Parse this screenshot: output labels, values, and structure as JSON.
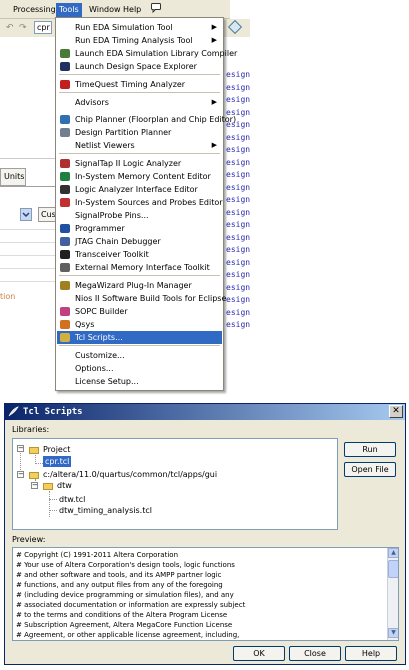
{
  "menubar": {
    "items": [
      "Processing",
      "Tools",
      "Window",
      "Help"
    ],
    "help_icon": "help-bubble-icon"
  },
  "toolbar": {
    "combo_value": "cpr"
  },
  "left_panel": {
    "units_tab": "Units",
    "cust_button": "Cust",
    "partial_text": "tion"
  },
  "code_lines": [
    "esign",
    "esign",
    "esign",
    "esign",
    "esign",
    "esign",
    "esign",
    "esign",
    "esign",
    "esign",
    "esign",
    "esign",
    "esign",
    "esign",
    "esign",
    "esign",
    "esign",
    "esign",
    "esign",
    "esign",
    "esign"
  ],
  "tools_menu": {
    "items": [
      {
        "label": "Run EDA Simulation Tool",
        "icon": "none",
        "submenu": true
      },
      {
        "label": "Run EDA Timing Analysis Tool",
        "icon": "none",
        "submenu": true
      },
      {
        "label": "Launch EDA Simulation Library Compiler",
        "icon": "library-compiler-icon"
      },
      {
        "label": "Launch Design Space Explorer",
        "icon": "design-space-explorer-icon"
      },
      {
        "label": "TimeQuest Timing Analyzer",
        "icon": "timequest-icon"
      },
      {
        "label": "Advisors",
        "icon": "none",
        "submenu": true
      },
      {
        "label": "Chip Planner (Floorplan and Chip Editor)",
        "icon": "chip-planner-icon"
      },
      {
        "label": "Design Partition Planner",
        "icon": "partition-planner-icon"
      },
      {
        "label": "Netlist Viewers",
        "icon": "none",
        "submenu": true
      },
      {
        "label": "SignalTap II Logic Analyzer",
        "icon": "signaltap-icon"
      },
      {
        "label": "In-System Memory Content Editor",
        "icon": "memory-editor-icon"
      },
      {
        "label": "Logic Analyzer Interface Editor",
        "icon": "logic-analyzer-icon"
      },
      {
        "label": "In-System Sources and Probes Editor",
        "icon": "sources-probes-icon"
      },
      {
        "label": "SignalProbe Pins...",
        "icon": "none"
      },
      {
        "label": "Programmer",
        "icon": "programmer-icon"
      },
      {
        "label": "JTAG Chain Debugger",
        "icon": "jtag-icon"
      },
      {
        "label": "Transceiver Toolkit",
        "icon": "transceiver-icon"
      },
      {
        "label": "External Memory Interface Toolkit",
        "icon": "memory-interface-icon"
      },
      {
        "label": "MegaWizard Plug-In Manager",
        "icon": "megawizard-icon"
      },
      {
        "label": "Nios II Software Build Tools for Eclipse",
        "icon": "none"
      },
      {
        "label": "SOPC Builder",
        "icon": "sopc-icon"
      },
      {
        "label": "Qsys",
        "icon": "qsys-icon"
      },
      {
        "label": "Tcl Scripts...",
        "icon": "tcl-icon",
        "selected": true
      },
      {
        "label": "Customize...",
        "icon": "none"
      },
      {
        "label": "Options...",
        "icon": "none"
      },
      {
        "label": "License Setup...",
        "icon": "none"
      }
    ]
  },
  "dialog": {
    "title": "Tcl Scripts",
    "libraries_label": "Libraries:",
    "tree": {
      "project": "Project",
      "project_file": "cpr.tcl",
      "path": "c:/altera/11.0/quartus/common/tcl/apps/gui",
      "dtw_folder": "dtw",
      "dtw_file": "dtw.tcl",
      "dtw_timing_file": "dtw_timing_analysis.tcl"
    },
    "run_button": "Run",
    "open_file_button": "Open File",
    "preview_label": "Preview:",
    "preview_lines": [
      "# Copyright (C) 1991-2011 Altera Corporation",
      "# Your use of Altera Corporation's design tools, logic functions",
      "# and other software and tools, and its AMPP partner logic",
      "# functions, and any output files from any of the foregoing",
      "# (including device programming or simulation files), and any",
      "# associated documentation or information are expressly subject",
      "# to the terms and conditions of the Altera Program License",
      "# Subscription Agreement, Altera MegaCore Function License",
      "# Agreement, or other applicable license agreement, including,"
    ],
    "ok_button": "OK",
    "close_button": "Close",
    "help_button": "Help"
  }
}
